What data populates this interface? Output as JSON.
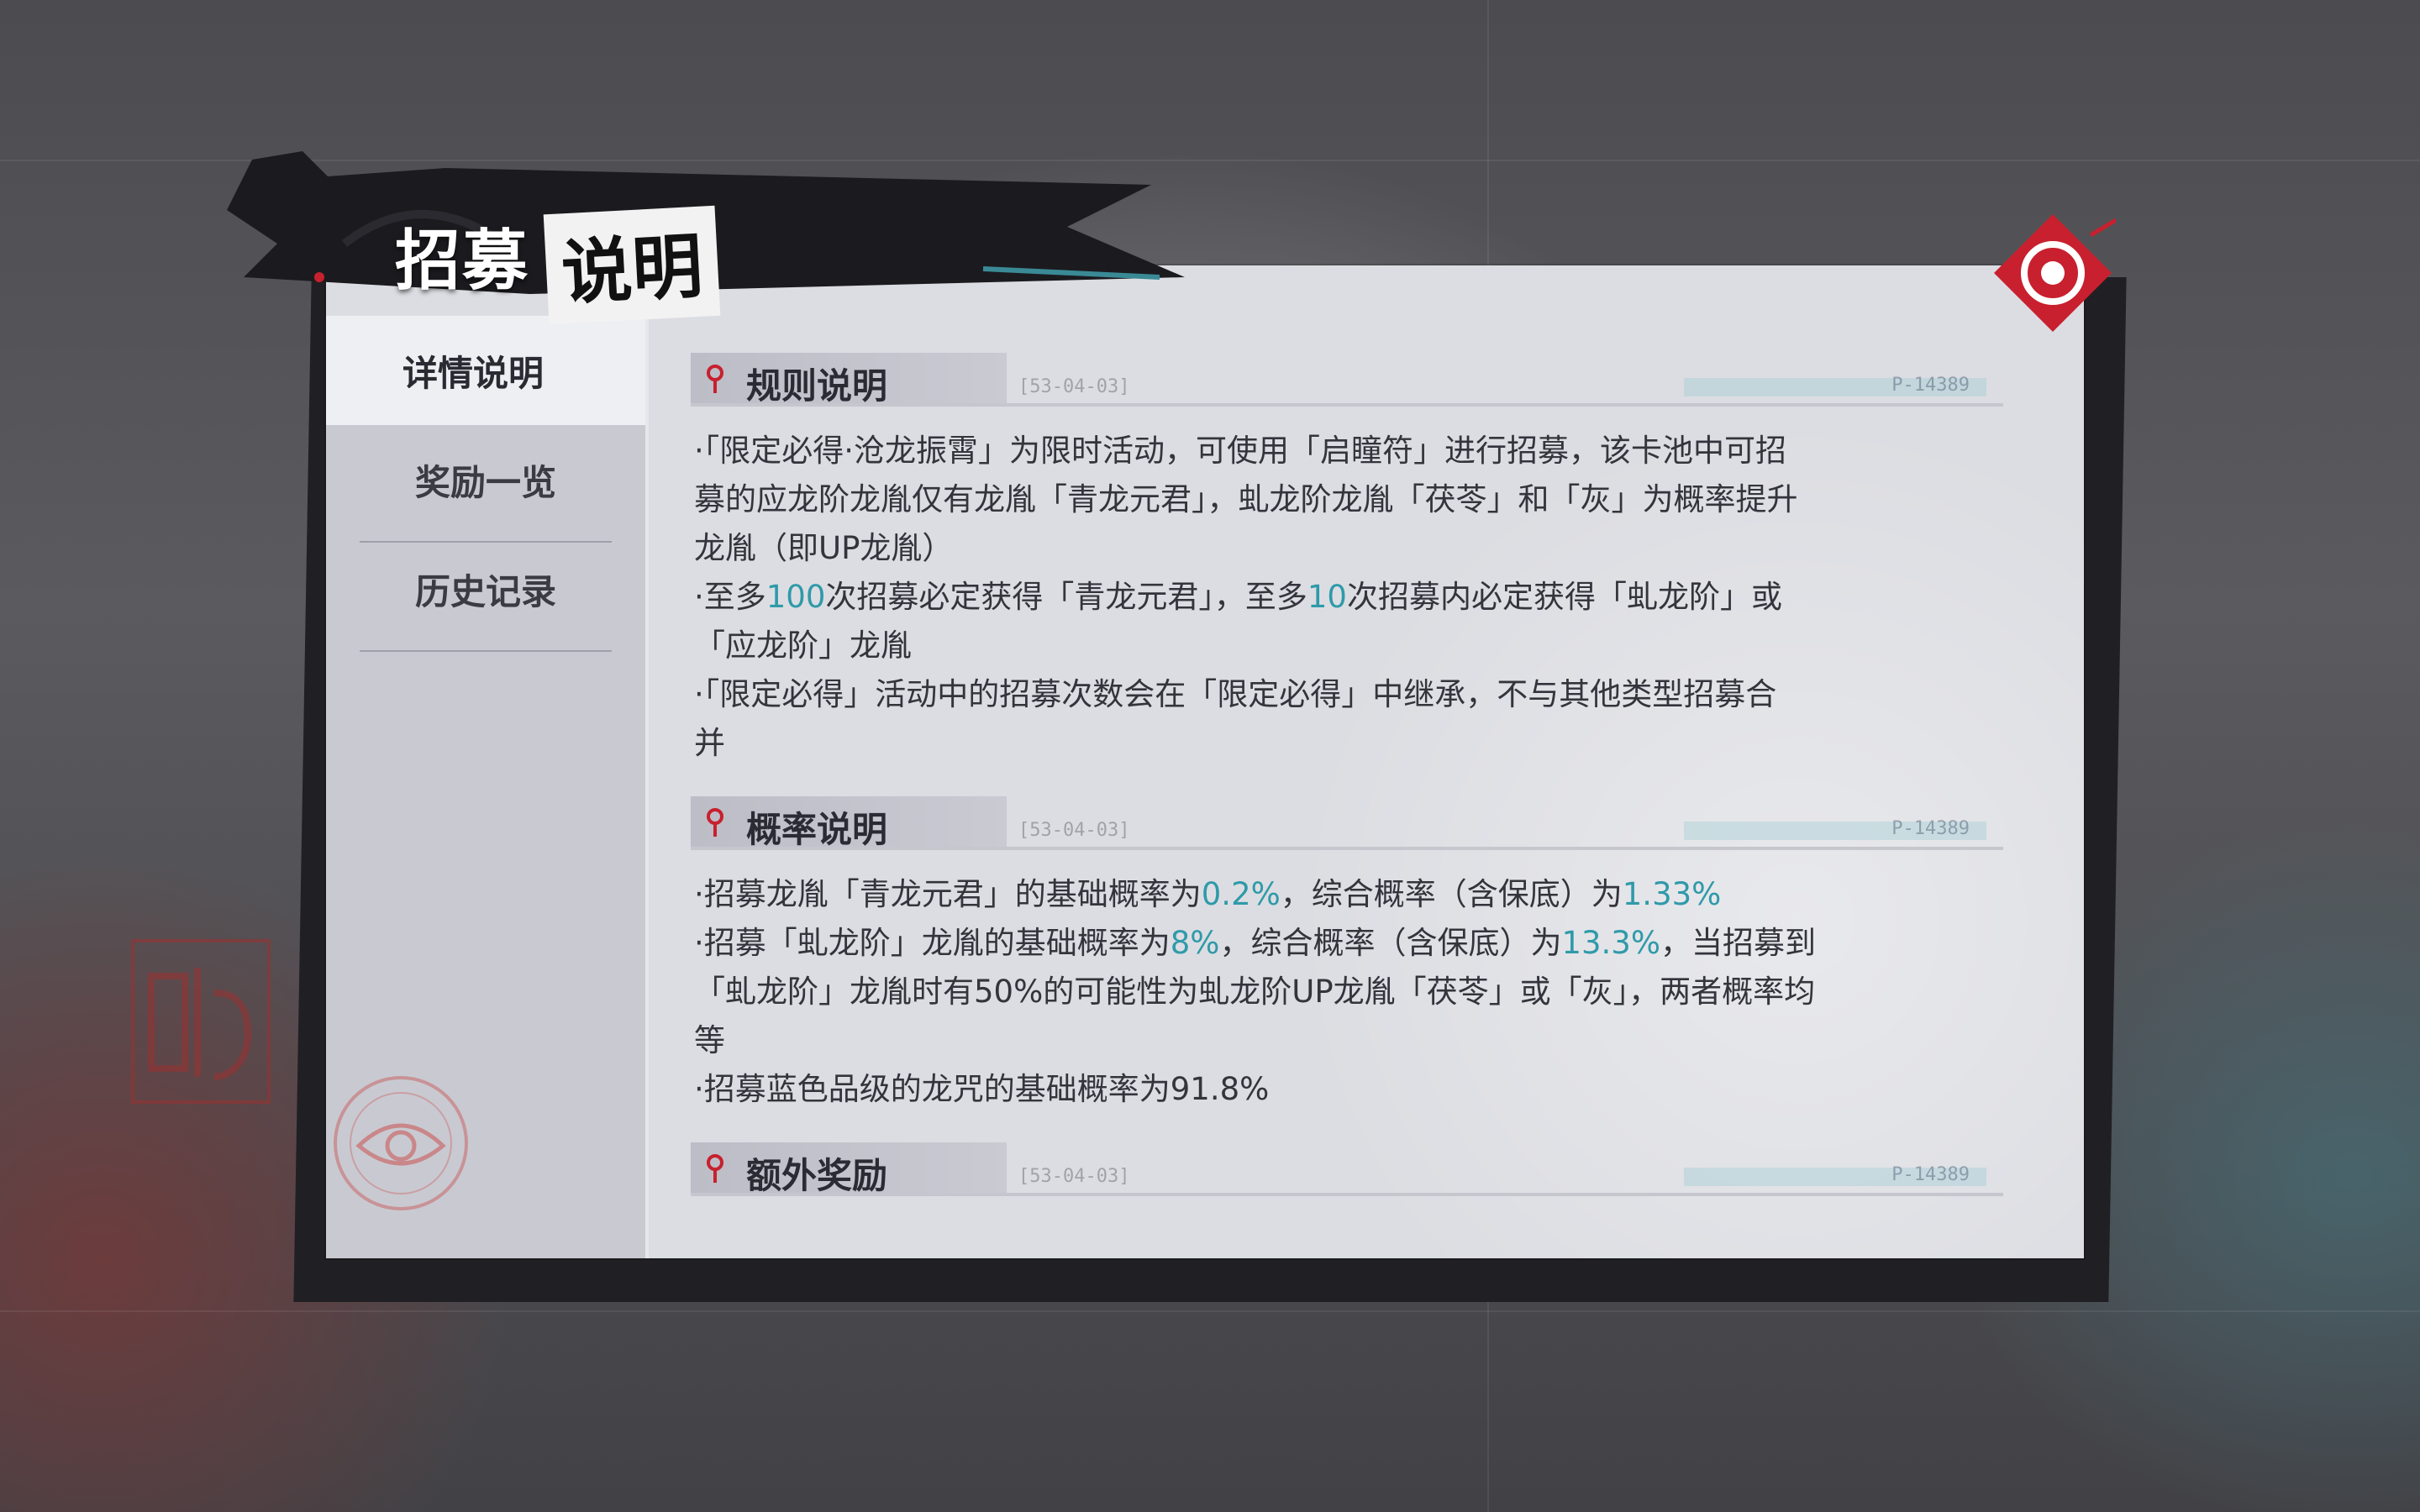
{
  "title": {
    "part1": "招募",
    "part2": "说明"
  },
  "close_icon": "close-eye-icon",
  "sidebar": {
    "items": [
      {
        "label": "详情说明",
        "active": true
      },
      {
        "label": "奖励一览",
        "active": false
      },
      {
        "label": "历史记录",
        "active": false
      }
    ]
  },
  "sections": [
    {
      "heading": "规则说明",
      "paragraphs": [
        {
          "lines": [
            [
              {
                "t": "·「限定必得·沧龙振霄」为限时活动，可使用「启瞳符」进行招募，该卡池中可招"
              }
            ],
            [
              {
                "t": "募的应龙阶龙胤仅有龙胤「青龙元君」，虬龙阶龙胤「茯苓」和「灰」为概率提升"
              }
            ],
            [
              {
                "t": "龙胤（即UP龙胤）"
              }
            ]
          ]
        },
        {
          "lines": [
            [
              {
                "t": "·至多"
              },
              {
                "t": "100",
                "hl": true
              },
              {
                "t": "次招募必定获得「青龙元君」，至多"
              },
              {
                "t": "10",
                "hl": true
              },
              {
                "t": "次招募内必定获得「虬龙阶」或"
              }
            ],
            [
              {
                "t": "「应龙阶」龙胤"
              }
            ]
          ]
        },
        {
          "lines": [
            [
              {
                "t": "·「限定必得」活动中的招募次数会在「限定必得」中继承，不与其他类型招募合"
              }
            ],
            [
              {
                "t": "并"
              }
            ]
          ]
        }
      ]
    },
    {
      "heading": "概率说明",
      "paragraphs": [
        {
          "lines": [
            [
              {
                "t": "·招募龙胤「青龙元君」的基础概率为"
              },
              {
                "t": "0.2%",
                "hl": true
              },
              {
                "t": "，综合概率（含保底）为"
              },
              {
                "t": "1.33%",
                "hl": true
              }
            ]
          ]
        },
        {
          "lines": [
            [
              {
                "t": "·招募「虬龙阶」龙胤的基础概率为"
              },
              {
                "t": "8%",
                "hl": true
              },
              {
                "t": "，综合概率（含保底）为"
              },
              {
                "t": "13.3%",
                "hl": true
              },
              {
                "t": "，当招募到"
              }
            ],
            [
              {
                "t": "「虬龙阶」龙胤时有50%的可能性为虬龙阶UP龙胤「茯苓」或「灰」，两者概率均"
              }
            ],
            [
              {
                "t": "等"
              }
            ]
          ]
        },
        {
          "lines": [
            [
              {
                "t": "·招募蓝色品级的龙咒的基础概率为91.8%"
              }
            ]
          ]
        }
      ]
    },
    {
      "heading": "额外奖励",
      "paragraphs": []
    }
  ],
  "section_decor": {
    "date_code": "[53-04-03]",
    "serial_code": "P-14389"
  },
  "colors": {
    "highlight": "#2f9aa9",
    "accent_red": "#c8202e",
    "panel": "#dcdde2",
    "sidebar": "#c9cad1"
  }
}
